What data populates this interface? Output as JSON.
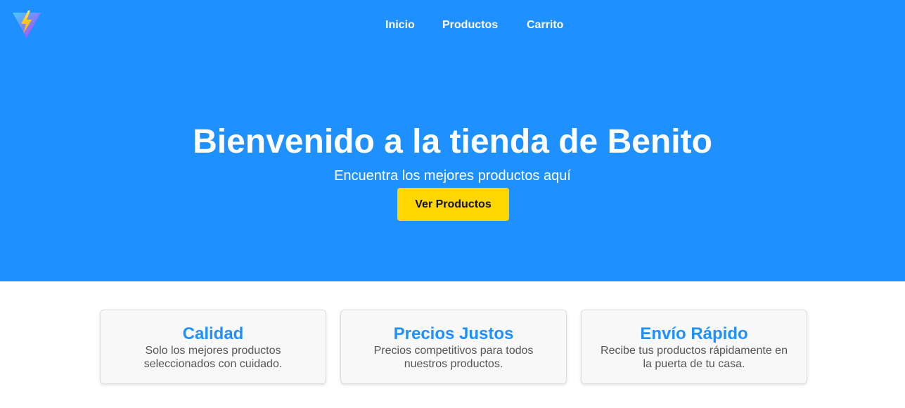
{
  "header": {
    "logo": "vite-logo-icon",
    "nav": [
      {
        "label": "Inicio"
      },
      {
        "label": "Productos"
      },
      {
        "label": "Carrito"
      }
    ]
  },
  "hero": {
    "title": "Bienvenido a la tienda de Benito",
    "subtitle": "Encuentra los mejores productos aquí",
    "button_label": "Ver Productos"
  },
  "features": [
    {
      "title": "Calidad",
      "description": "Solo los mejores productos seleccionados con cuidado."
    },
    {
      "title": "Precios Justos",
      "description": "Precios competitivos para todos nuestros productos."
    },
    {
      "title": "Envío Rápido",
      "description": "Recibe tus productos rápidamente en la puerta de tu casa."
    }
  ],
  "colors": {
    "hero_background": "#1e90ff",
    "accent_button": "#ffd700",
    "card_title": "#1e90ff",
    "card_background": "#f8f8f8"
  }
}
